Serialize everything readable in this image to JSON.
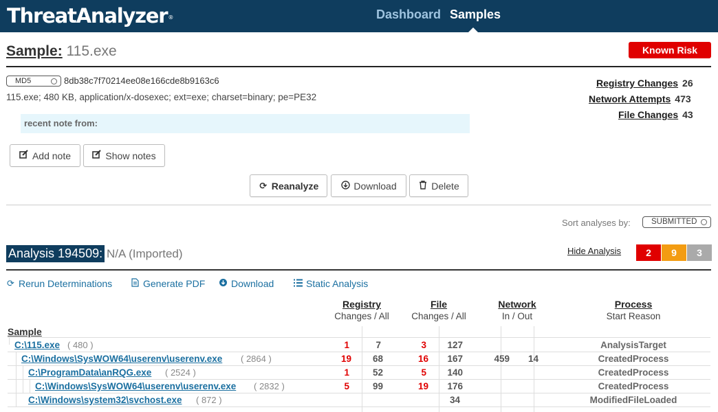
{
  "header": {
    "logo": "ThreatAnalyzer",
    "logo_mark": "®",
    "nav": {
      "dashboard": "Dashboard",
      "samples": "Samples"
    }
  },
  "sample": {
    "title_label": "Sample:",
    "name": "115.exe",
    "risk_badge": "Known Risk",
    "hash_type": "MD5",
    "hash": "8db38c7f70214ee08e166cde8b9163c6",
    "file_info": "115.exe; 480 KB, application/x-dosexec; ext=exe; charset=binary; pe=PE32",
    "note_label": "recent note from:",
    "stats": {
      "registry_label": "Registry Changes",
      "registry_value": "26",
      "network_label": "Network Attempts",
      "network_value": "473",
      "file_label": "File Changes",
      "file_value": "43"
    },
    "buttons": {
      "add_note": "Add note",
      "show_notes": "Show notes",
      "reanalyze": "Reanalyze",
      "download": "Download",
      "delete": "Delete"
    }
  },
  "sort": {
    "label": "Sort analyses by:",
    "value": "SUBMITTED"
  },
  "analysis": {
    "id_label": "Analysis 194509:",
    "note": "N/A (Imported)",
    "hide_label": "Hide Analysis",
    "severity": {
      "red": "2",
      "orange": "9",
      "gray": "3",
      "colors": {
        "red": "#e00000",
        "orange": "#f39c12",
        "gray": "#aaaaaa"
      }
    },
    "links": {
      "rerun": "Rerun Determinations",
      "pdf": "Generate PDF",
      "download": "Download",
      "static": "Static Analysis"
    },
    "columns": {
      "registry": "Registry",
      "registry_sub": "Changes / All",
      "file": "File",
      "file_sub": "Changes / All",
      "network": "Network",
      "network_sub": "In / Out",
      "process": "Process",
      "process_sub": "Start Reason"
    },
    "sample_header": "Sample",
    "rows": [
      {
        "path": "C:\\115.exe",
        "pid": "( 480 )",
        "reg_changes": "1",
        "reg_all": "7",
        "file_changes": "3",
        "file_all": "127",
        "net_in": "",
        "net_out": "",
        "reason": "AnalysisTarget"
      },
      {
        "path": "C:\\Windows\\SysWOW64\\userenv\\userenv.exe",
        "pid": "( 2864 )",
        "reg_changes": "19",
        "reg_all": "68",
        "file_changes": "16",
        "file_all": "167",
        "net_in": "459",
        "net_out": "14",
        "reason": "CreatedProcess"
      },
      {
        "path": "C:\\ProgramData\\anRQG.exe",
        "pid": "( 2524 )",
        "reg_changes": "1",
        "reg_all": "52",
        "file_changes": "5",
        "file_all": "140",
        "net_in": "",
        "net_out": "",
        "reason": "CreatedProcess"
      },
      {
        "path": "C:\\Windows\\SysWOW64\\userenv\\userenv.exe",
        "pid": "( 2832 )",
        "reg_changes": "5",
        "reg_all": "99",
        "file_changes": "19",
        "file_all": "176",
        "net_in": "",
        "net_out": "",
        "reason": "CreatedProcess"
      },
      {
        "path": "C:\\Windows\\system32\\svchost.exe",
        "pid": "( 872 )",
        "reg_changes": "",
        "reg_all": "",
        "file_changes": "",
        "file_all": "34",
        "net_in": "",
        "net_out": "",
        "reason": "ModifiedFileLoaded"
      }
    ]
  }
}
